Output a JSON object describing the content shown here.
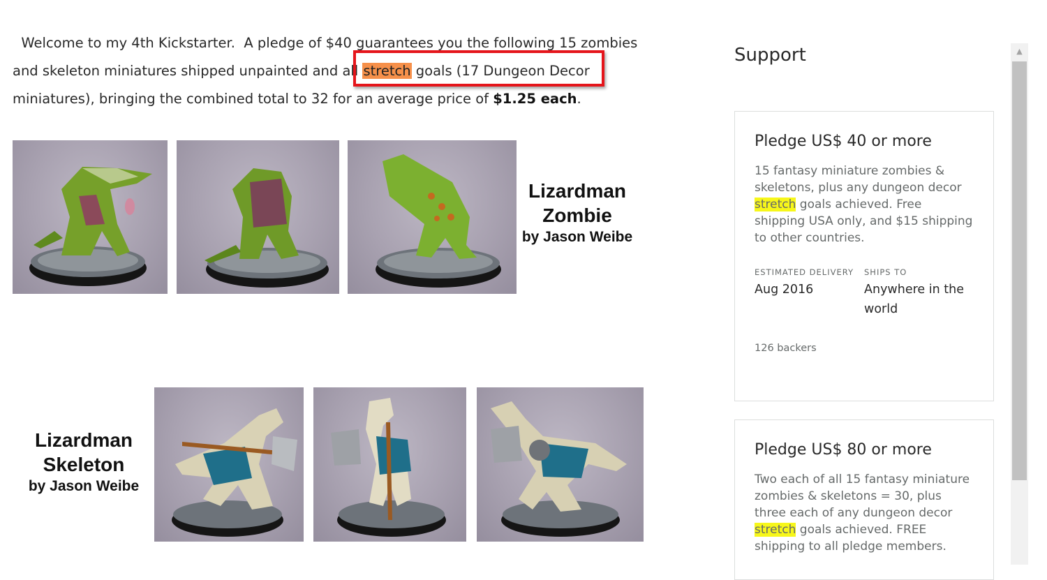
{
  "intro": {
    "part1": "  Welcome to my 4th Kickstarter.  A pledge of $40 guarantees you the following 15 zombies and skeleton miniatures shipped unpainted and all ",
    "highlight": "stretch",
    "part2": " goals (17 Dungeon Decor miniatures), bringing the combined total to 32 for an average price of ",
    "price": "$1.25 each",
    "end": "."
  },
  "zombie_caption": {
    "line1": "Lizardman",
    "line2": "Zombie",
    "line3": "by Jason Weibe"
  },
  "skeleton_caption": {
    "line1": "Lizardman",
    "line2": "Skeleton",
    "line3": "by Jason Weibe"
  },
  "support": {
    "title": "Support",
    "reward1": {
      "title": "Pledge US$ 40 or more",
      "desc_before": "15 fantasy miniature zombies & skeletons, plus any dungeon decor ",
      "desc_highlight": "stretch",
      "desc_after": " goals achieved. Free shipping USA only, and $15 shipping to other countries.",
      "delivery_label": "ESTIMATED DELIVERY",
      "delivery_value": "Aug 2016",
      "ships_label": "SHIPS TO",
      "ships_value": "Anywhere in the world",
      "backers": "126 backers"
    },
    "reward2": {
      "title": "Pledge US$ 80 or more",
      "desc_before": "Two each of all 15 fantasy miniature zombies & skeletons = 30, plus three each of any dungeon decor ",
      "desc_highlight": "stretch",
      "desc_after": " goals achieved. FREE shipping to all pledge members."
    }
  },
  "colors": {
    "find_highlight_active": "#f6904a",
    "find_highlight": "#f7f71a",
    "callout_border": "#e5151b"
  },
  "icons": {
    "scroll_up": "scroll-up-arrow-icon"
  }
}
